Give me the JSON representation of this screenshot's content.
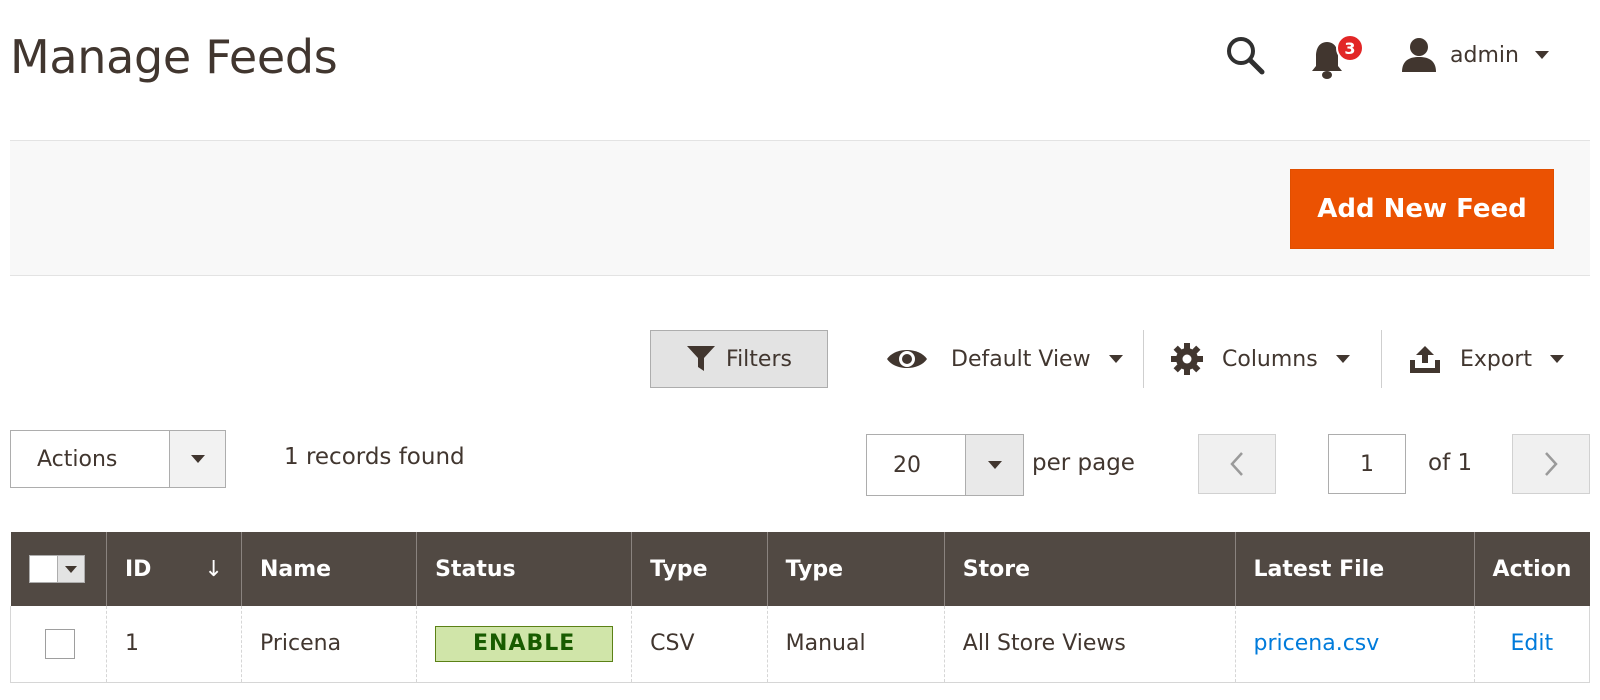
{
  "header": {
    "title": "Manage Feeds",
    "notifications_count": "3",
    "user_name": "admin",
    "icons": [
      "search-icon",
      "bell-icon",
      "user-icon"
    ]
  },
  "action_bar": {
    "add_button_label": "Add New Feed",
    "accent_color": "#eb5202"
  },
  "toolbar": {
    "filters_label": "Filters",
    "view_label": "Default View",
    "columns_label": "Columns",
    "export_label": "Export"
  },
  "grid_controls": {
    "actions_label": "Actions",
    "records_found": "1 records found",
    "per_page_value": "20",
    "per_page_label": "per page",
    "current_page": "1",
    "total_pages_label": "of 1"
  },
  "table": {
    "columns": [
      "ID",
      "Name",
      "Status",
      "Type",
      "Type",
      "Store",
      "Latest File",
      "Action"
    ],
    "header_bg": "#514943",
    "rows": [
      {
        "id": "1",
        "name": "Pricena",
        "status": "ENABLE",
        "type1": "CSV",
        "type2": "Manual",
        "store": "All Store Views",
        "latest_file": "pricena.csv",
        "action": "Edit"
      }
    ]
  }
}
